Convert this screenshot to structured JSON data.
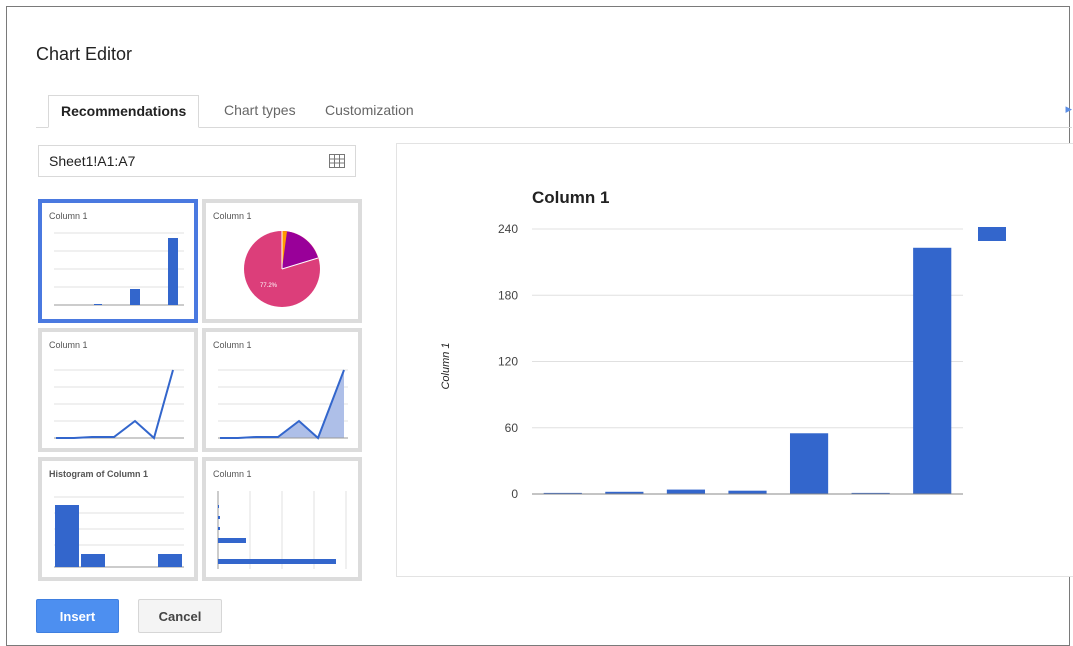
{
  "dialog": {
    "title": "Chart Editor",
    "tabs": [
      {
        "label": "Recommendations",
        "active": true
      },
      {
        "label": "Chart types",
        "active": false
      },
      {
        "label": "Customization",
        "active": false
      }
    ],
    "data_range": "Sheet1!A1:A7",
    "insert_label": "Insert",
    "cancel_label": "Cancel"
  },
  "thumbnails": [
    {
      "title": "Column 1",
      "kind": "column",
      "selected": true
    },
    {
      "title": "Column 1",
      "kind": "pie",
      "slice_label": "77.2%"
    },
    {
      "title": "Column 1",
      "kind": "line"
    },
    {
      "title": "Column 1",
      "kind": "area"
    },
    {
      "title": "Histogram of Column 1",
      "kind": "histogram"
    },
    {
      "title": "Column 1",
      "kind": "bar"
    }
  ],
  "colors": {
    "series": "#3366cc",
    "selected_border": "#4a79e0",
    "pie_main": "#dc3e7a",
    "pie_second": "#990099",
    "insert_button": "#4d8ff0"
  },
  "chart_data": {
    "type": "bar",
    "title": "Column 1",
    "xlabel": "",
    "ylabel": "Column 1",
    "ylim": [
      0,
      240
    ],
    "yticks": [
      0,
      60,
      120,
      180,
      240
    ],
    "values": [
      1,
      2,
      4,
      3,
      55,
      1,
      223
    ],
    "grid": true,
    "legend_position": "top-right"
  }
}
